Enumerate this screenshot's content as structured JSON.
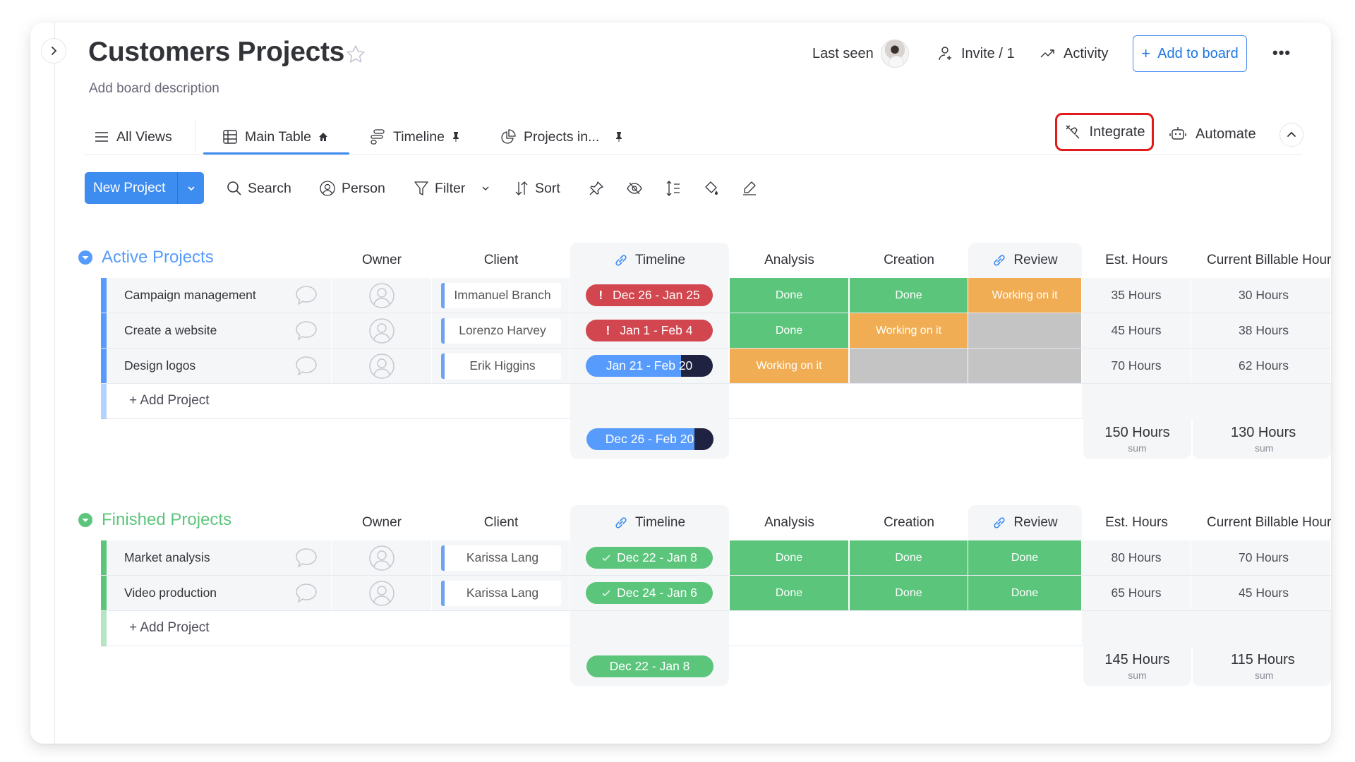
{
  "header": {
    "title": "Customers Projects",
    "description": "Add board description",
    "last_seen_label": "Last seen",
    "invite_label": "Invite / 1",
    "activity_label": "Activity",
    "add_to_board_label": "Add to board",
    "more_label": "•••"
  },
  "tabs": [
    {
      "label": "All Views"
    },
    {
      "label": "Main Table",
      "active": true
    },
    {
      "label": "Timeline"
    },
    {
      "label": "Projects in..."
    }
  ],
  "actions": {
    "integrate_label": "Integrate",
    "automate_label": "Automate"
  },
  "toolbar": {
    "new_project_label": "New Project",
    "search_label": "Search",
    "person_label": "Person",
    "filter_label": "Filter",
    "sort_label": "Sort"
  },
  "colors": {
    "accent": "#3d8cf0",
    "done": "#5cc57c",
    "working": "#f0ad54",
    "empty": "#c4c4c4",
    "stuck": "#d2474f",
    "dark": "#1f2240",
    "highlight": "#e11b1b"
  },
  "columns": {
    "owner": "Owner",
    "client": "Client",
    "timeline": "Timeline",
    "analysis": "Analysis",
    "creation": "Creation",
    "review": "Review",
    "est_hours": "Est. Hours",
    "current_billable": "Current Billable Hours"
  },
  "groups": [
    {
      "title": "Active Projects",
      "color": "#579bfc",
      "add_label": "+ Add Project",
      "rows": [
        {
          "name": "Campaign management",
          "client": "Immanuel Branch",
          "timeline": "Dec 26 - Jan 25",
          "timeline_state": "overdue",
          "analysis": "Done",
          "creation": "Done",
          "review": "Working on it",
          "est_hours": "35 Hours",
          "current": "30 Hours"
        },
        {
          "name": "Create a website",
          "client": "Lorenzo Harvey",
          "timeline": "Jan 1 - Feb 4",
          "timeline_state": "overdue",
          "analysis": "Done",
          "creation": "Working on it",
          "review": "",
          "est_hours": "45 Hours",
          "current": "38 Hours"
        },
        {
          "name": "Design logos",
          "client": "Erik Higgins",
          "timeline": "Jan 21 - Feb 20",
          "timeline_state": "in-progress",
          "timeline_progress": 0.75,
          "analysis": "Working on it",
          "creation": "",
          "review": "",
          "est_hours": "70 Hours",
          "current": "62 Hours"
        }
      ],
      "summary": {
        "timeline": "Dec 26 - Feb 20",
        "timeline_progress": 0.85,
        "est_hours": "150 Hours",
        "current": "130 Hours",
        "sum_label": "sum"
      }
    },
    {
      "title": "Finished Projects",
      "color": "#5cc57c",
      "add_label": "+ Add Project",
      "rows": [
        {
          "name": "Market analysis",
          "client": "Karissa Lang",
          "timeline": "Dec 22 - Jan 8",
          "timeline_state": "done",
          "analysis": "Done",
          "creation": "Done",
          "review": "Done",
          "est_hours": "80 Hours",
          "current": "70 Hours"
        },
        {
          "name": "Video production",
          "client": "Karissa Lang",
          "timeline": "Dec 24 - Jan 6",
          "timeline_state": "done",
          "analysis": "Done",
          "creation": "Done",
          "review": "Done",
          "est_hours": "65 Hours",
          "current": "45 Hours"
        }
      ],
      "summary": {
        "timeline": "Dec 22 - Jan 8",
        "est_hours": "145 Hours",
        "current": "115 Hours",
        "sum_label": "sum"
      }
    }
  ]
}
